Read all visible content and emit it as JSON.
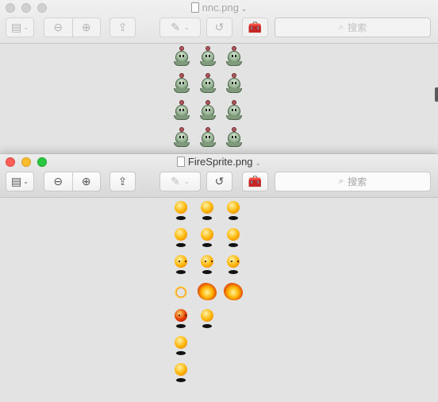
{
  "back_window": {
    "title": "nnc.png",
    "search_placeholder": "搜索"
  },
  "front_window": {
    "title": "FireSprite.png",
    "search_placeholder": "搜索"
  },
  "icons": {
    "sidebar": "sidebar-icon",
    "zoom_out": "zoom-out-icon",
    "zoom_in": "zoom-in-icon",
    "share": "share-icon",
    "markup": "markup-pen-icon",
    "rotate": "rotate-icon",
    "toolbox": "toolbox-icon",
    "search": "search-icon"
  },
  "back_sprites": {
    "columns": 3,
    "rows": 4
  },
  "front_sprites": {
    "columns": 3,
    "cells": [
      "ball",
      "ball",
      "ball",
      "ball",
      "ball",
      "ball",
      "face",
      "face",
      "face",
      "scatter",
      "burst",
      "burst",
      "red",
      "ball",
      "empty",
      "ball",
      "empty",
      "empty",
      "ball",
      "empty",
      "empty"
    ]
  }
}
